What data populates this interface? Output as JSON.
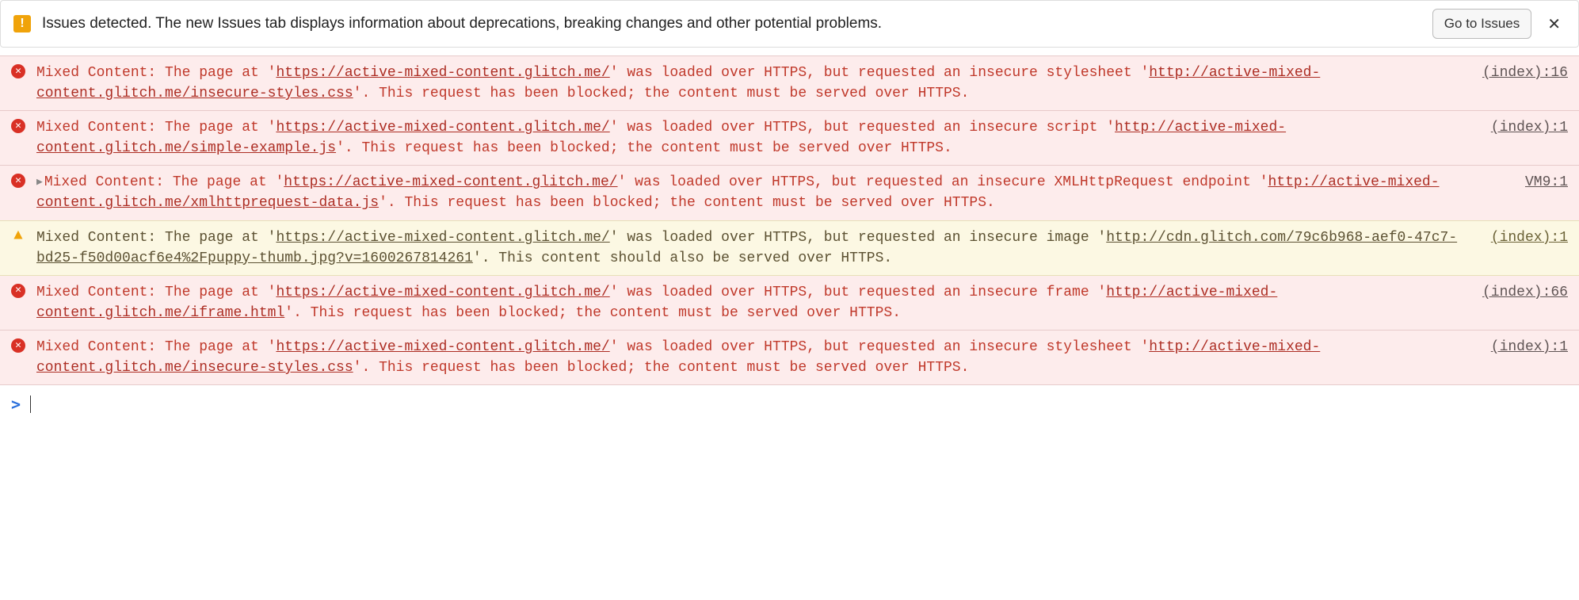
{
  "infobar": {
    "text": "Issues detected. The new Issues tab displays information about deprecations, breaking changes and other potential problems.",
    "button": "Go to Issues"
  },
  "page_url": "https://active-mixed-content.glitch.me/",
  "messages": [
    {
      "level": "error",
      "expandable": false,
      "source": "(index):16",
      "prefix": "Mixed Content: The page at '",
      "mid1": "' was loaded over HTTPS, but requested an insecure stylesheet '",
      "resource": "http://active-mixed-content.glitch.me/insecure-styles.css",
      "suffix": "'. This request has been blocked; the content must be served over HTTPS."
    },
    {
      "level": "error",
      "expandable": false,
      "source": "(index):1",
      "prefix": "Mixed Content: The page at '",
      "mid1": "' was loaded over HTTPS, but requested an insecure script '",
      "resource": "http://active-mixed-content.glitch.me/simple-example.js",
      "suffix": "'. This request has been blocked; the content must be served over HTTPS."
    },
    {
      "level": "error",
      "expandable": true,
      "source": "VM9:1",
      "prefix": "Mixed Content: The page at '",
      "mid1": "' was loaded over HTTPS, but requested an insecure XMLHttpRequest endpoint '",
      "resource": "http://active-mixed-content.glitch.me/xmlhttprequest-data.js",
      "suffix": "'. This request has been blocked; the content must be served over HTTPS."
    },
    {
      "level": "warn",
      "expandable": false,
      "source": "(index):1",
      "prefix": "Mixed Content: The page at '",
      "mid1": "' was loaded over HTTPS, but requested an insecure image '",
      "resource": "http://cdn.glitch.com/79c6b968-aef0-47c7-bd25-f50d00acf6e4%2Fpuppy-thumb.jpg?v=1600267814261",
      "suffix": "'. This content should also be served over HTTPS."
    },
    {
      "level": "error",
      "expandable": false,
      "source": "(index):66",
      "prefix": "Mixed Content: The page at '",
      "mid1": "' was loaded over HTTPS, but requested an insecure frame '",
      "resource": "http://active-mixed-content.glitch.me/iframe.html",
      "suffix": "'. This request has been blocked; the content must be served over HTTPS."
    },
    {
      "level": "error",
      "expandable": false,
      "source": "(index):1",
      "prefix": "Mixed Content: The page at '",
      "mid1": "' was loaded over HTTPS, but requested an insecure stylesheet '",
      "resource": "http://active-mixed-content.glitch.me/insecure-styles.css",
      "suffix": "'. This request has been blocked; the content must be served over HTTPS."
    }
  ]
}
